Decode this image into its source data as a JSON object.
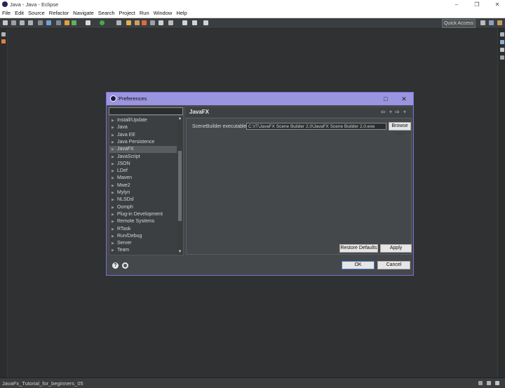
{
  "window": {
    "title": "Java - Java - Eclipse",
    "minimize_glyph": "–",
    "maximize_glyph": "❐",
    "close_glyph": "✕"
  },
  "menu": [
    "File",
    "Edit",
    "Source",
    "Refactor",
    "Navigate",
    "Search",
    "Project",
    "Run",
    "Window",
    "Help"
  ],
  "toolbar": {
    "quick_access": "Quick Access"
  },
  "status": {
    "text": "JavaFx_Tutorial_for_beginners_05"
  },
  "dialog": {
    "title": "Preferences",
    "maximize_glyph": "□",
    "close_glyph": "✕",
    "filter_value": "",
    "tree_items": [
      {
        "label": "Install/Update",
        "selected": false
      },
      {
        "label": "Java",
        "selected": false
      },
      {
        "label": "Java EE",
        "selected": false
      },
      {
        "label": "Java Persistence",
        "selected": false
      },
      {
        "label": "JavaFX",
        "selected": true
      },
      {
        "label": "JavaScript",
        "selected": false
      },
      {
        "label": "JSON",
        "selected": false
      },
      {
        "label": "LDef",
        "selected": false
      },
      {
        "label": "Maven",
        "selected": false
      },
      {
        "label": "Mwe2",
        "selected": false
      },
      {
        "label": "Mylyn",
        "selected": false
      },
      {
        "label": "NLSDsl",
        "selected": false
      },
      {
        "label": "Oomph",
        "selected": false
      },
      {
        "label": "Plug-in Development",
        "selected": false
      },
      {
        "label": "Remote Systems",
        "selected": false
      },
      {
        "label": "RTask",
        "selected": false
      },
      {
        "label": "Run/Debug",
        "selected": false
      },
      {
        "label": "Server",
        "selected": false
      },
      {
        "label": "Team",
        "selected": false
      }
    ],
    "panel": {
      "title": "JavaFX",
      "back_glyph": "⇦",
      "forward_glyph": "⇨",
      "menu_glyph": "▾",
      "scenebuilder_label": "SceneBuilder executable",
      "scenebuilder_path": "C:\\IT\\JavaFX Scene Builder 2.0\\JavaFX Scene Builder 2.0.exe",
      "browse_label": "Browse ...",
      "restore_defaults_label": "Restore Defaults",
      "apply_label": "Apply"
    },
    "help_glyph": "?",
    "ok_label": "OK",
    "cancel_label": "Cancel"
  }
}
